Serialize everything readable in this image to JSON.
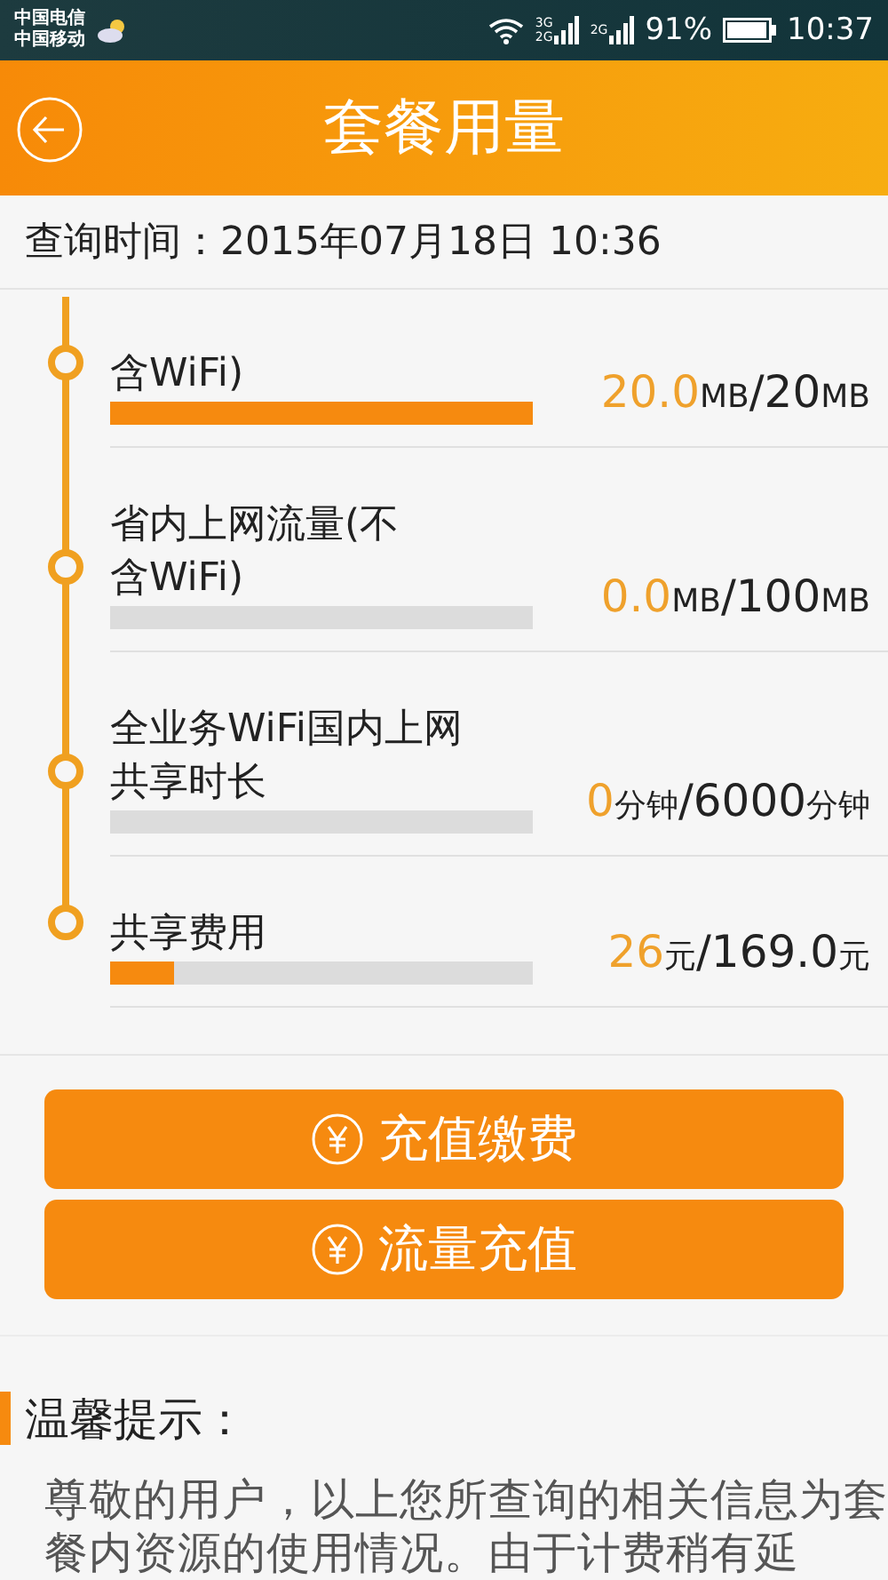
{
  "status_bar": {
    "carriers": [
      "中国电信",
      "中国移动"
    ],
    "signals": [
      {
        "label_top": "3G",
        "label_bottom": "2G"
      },
      {
        "label_top": "2G"
      }
    ],
    "battery": "91%",
    "time": "10:37"
  },
  "header": {
    "title": "套餐用量"
  },
  "query_time": "查询时间：2015年07月18日 10:36",
  "usage_items": [
    {
      "label_lines": [
        "含WiFi)"
      ],
      "level": 1.0,
      "used": "20.0",
      "used_unit": "MB",
      "quota": "/20",
      "quota_unit": "MB"
    },
    {
      "label_lines": [
        "省内上网流量(不",
        "含WiFi)"
      ],
      "level": 0,
      "used": "0.0",
      "used_unit": "MB",
      "quota": "/100",
      "quota_unit": "MB"
    },
    {
      "label_lines": [
        "全业务WiFi国内上网",
        "共享时长"
      ],
      "level": 0,
      "used": "0",
      "used_unit": "分钟",
      "quota": "/6000",
      "quota_unit": "分钟"
    },
    {
      "label_lines": [
        "共享费用"
      ],
      "level": 0.15,
      "used": "26",
      "used_unit": "元",
      "quota": "/169.0",
      "quota_unit": "元"
    }
  ],
  "buttons": [
    "充值缴费",
    "流量充值"
  ],
  "tips": {
    "title": "温馨提示：",
    "text": "尊敬的用户，以上您所查询的相关信息为套餐内资源的使用情况。由于计费稍有延"
  }
}
